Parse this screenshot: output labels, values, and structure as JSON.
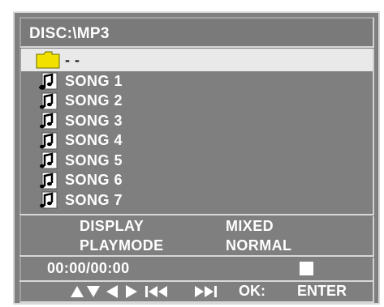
{
  "title": "DISC:\\MP3",
  "files": [
    {
      "label": "- -",
      "type": "folder",
      "selected": true
    },
    {
      "label": "SONG 1",
      "type": "audio",
      "selected": false
    },
    {
      "label": "SONG 2",
      "type": "audio",
      "selected": false
    },
    {
      "label": "SONG 3",
      "type": "audio",
      "selected": false
    },
    {
      "label": "SONG 4",
      "type": "audio",
      "selected": false
    },
    {
      "label": "SONG 5",
      "type": "audio",
      "selected": false
    },
    {
      "label": "SONG 6",
      "type": "audio",
      "selected": false
    },
    {
      "label": "SONG 7",
      "type": "audio",
      "selected": false
    }
  ],
  "settings": {
    "display": {
      "name": "DISPLAY",
      "value": "MIXED"
    },
    "playmode": {
      "name": "PLAYMODE",
      "value": "NORMAL"
    }
  },
  "time": "00:00/00:00",
  "playback_state_icon": "stop-icon",
  "nav": {
    "icons": [
      "up-arrow-icon",
      "down-arrow-icon",
      "left-arrow-icon",
      "right-arrow-icon",
      "previous-track-icon",
      "next-track-icon"
    ],
    "ok_label": "OK:",
    "enter_label": "ENTER"
  },
  "colors": {
    "panel": "#7f7f7f",
    "highlight": "#e9e9e9",
    "folder": "#f2e000",
    "text": "#ffffff"
  }
}
